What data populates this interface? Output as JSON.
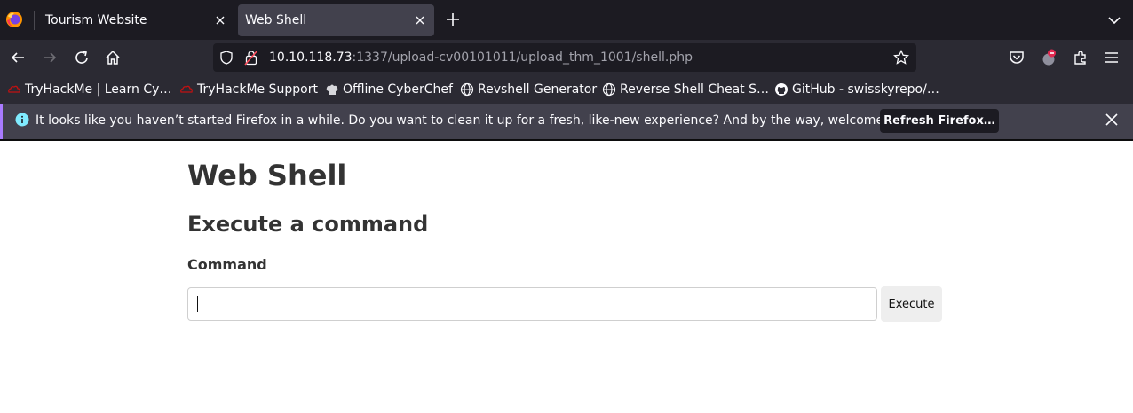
{
  "browser": {
    "tabs": [
      {
        "title": "Tourism Website",
        "active": false
      },
      {
        "title": "Web Shell",
        "active": true
      }
    ],
    "url": {
      "host": "10.10.118.73",
      "rest": ":1337/upload-cv00101011/upload_thm_1001/shell.php"
    },
    "bookmarks": [
      {
        "label": "TryHackMe | Learn Cy…",
        "icon": "tryhackme-icon"
      },
      {
        "label": "TryHackMe Support",
        "icon": "tryhackme-icon"
      },
      {
        "label": "Offline CyberChef",
        "icon": "chef-hat-icon"
      },
      {
        "label": "Revshell Generator",
        "icon": "globe-icon"
      },
      {
        "label": "Reverse Shell Cheat S…",
        "icon": "globe-icon"
      },
      {
        "label": "GitHub - swisskyrepo/…",
        "icon": "github-icon"
      }
    ],
    "notification": {
      "message": "It looks like you haven’t started Firefox in a while. Do you want to clean it up for a fresh, like-new experience? And by the way, welcome back!",
      "button": "Refresh Firefox…"
    }
  },
  "page": {
    "title": "Web Shell",
    "subtitle": "Execute a command",
    "command_label": "Command",
    "command_value": "",
    "execute_label": "Execute"
  },
  "colors": {
    "tabstrip": "#1c1b22",
    "toolbar": "#2b2a33",
    "active_tab": "#42414d",
    "notification_accent": "#a97bff",
    "heading_text": "#333333"
  }
}
